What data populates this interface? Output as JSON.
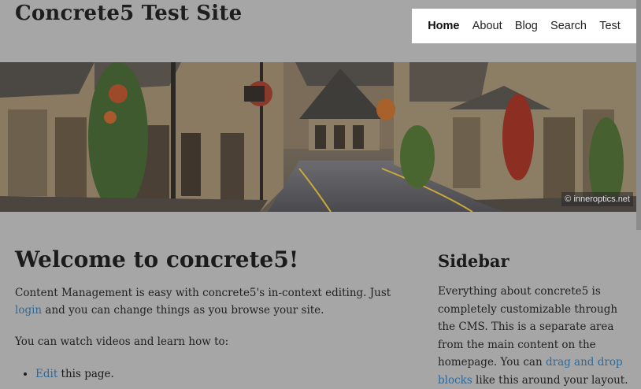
{
  "header": {
    "site_title": "Concrete5 Test Site"
  },
  "nav": {
    "items": [
      {
        "label": "Home",
        "active": true
      },
      {
        "label": "About",
        "active": false
      },
      {
        "label": "Blog",
        "active": false
      },
      {
        "label": "Search",
        "active": false
      },
      {
        "label": "Test",
        "active": false
      }
    ]
  },
  "banner": {
    "credit": "© inneroptics.net"
  },
  "main": {
    "heading": "Welcome to concrete5!",
    "p1_text": "Content Management is easy with concrete5's in-context editing. Just ",
    "p1_link": "login",
    "p1_text2": " and you can change things as you browse your site.",
    "p2_text": "You can watch videos and learn how to:",
    "list_item_link": "Edit",
    "list_item_text": " this page."
  },
  "sidebar": {
    "heading": "Sidebar",
    "text1": "Everything about concrete5 is completely customizable through the CMS. This is a separate area from the main content on the homepage. You can ",
    "link": "drag and drop blocks",
    "text2": " like this around your layout."
  },
  "colors": {
    "page_bg": "#a6a6a6",
    "link": "#2a6a9e",
    "nav_bg": "#ffffff"
  }
}
